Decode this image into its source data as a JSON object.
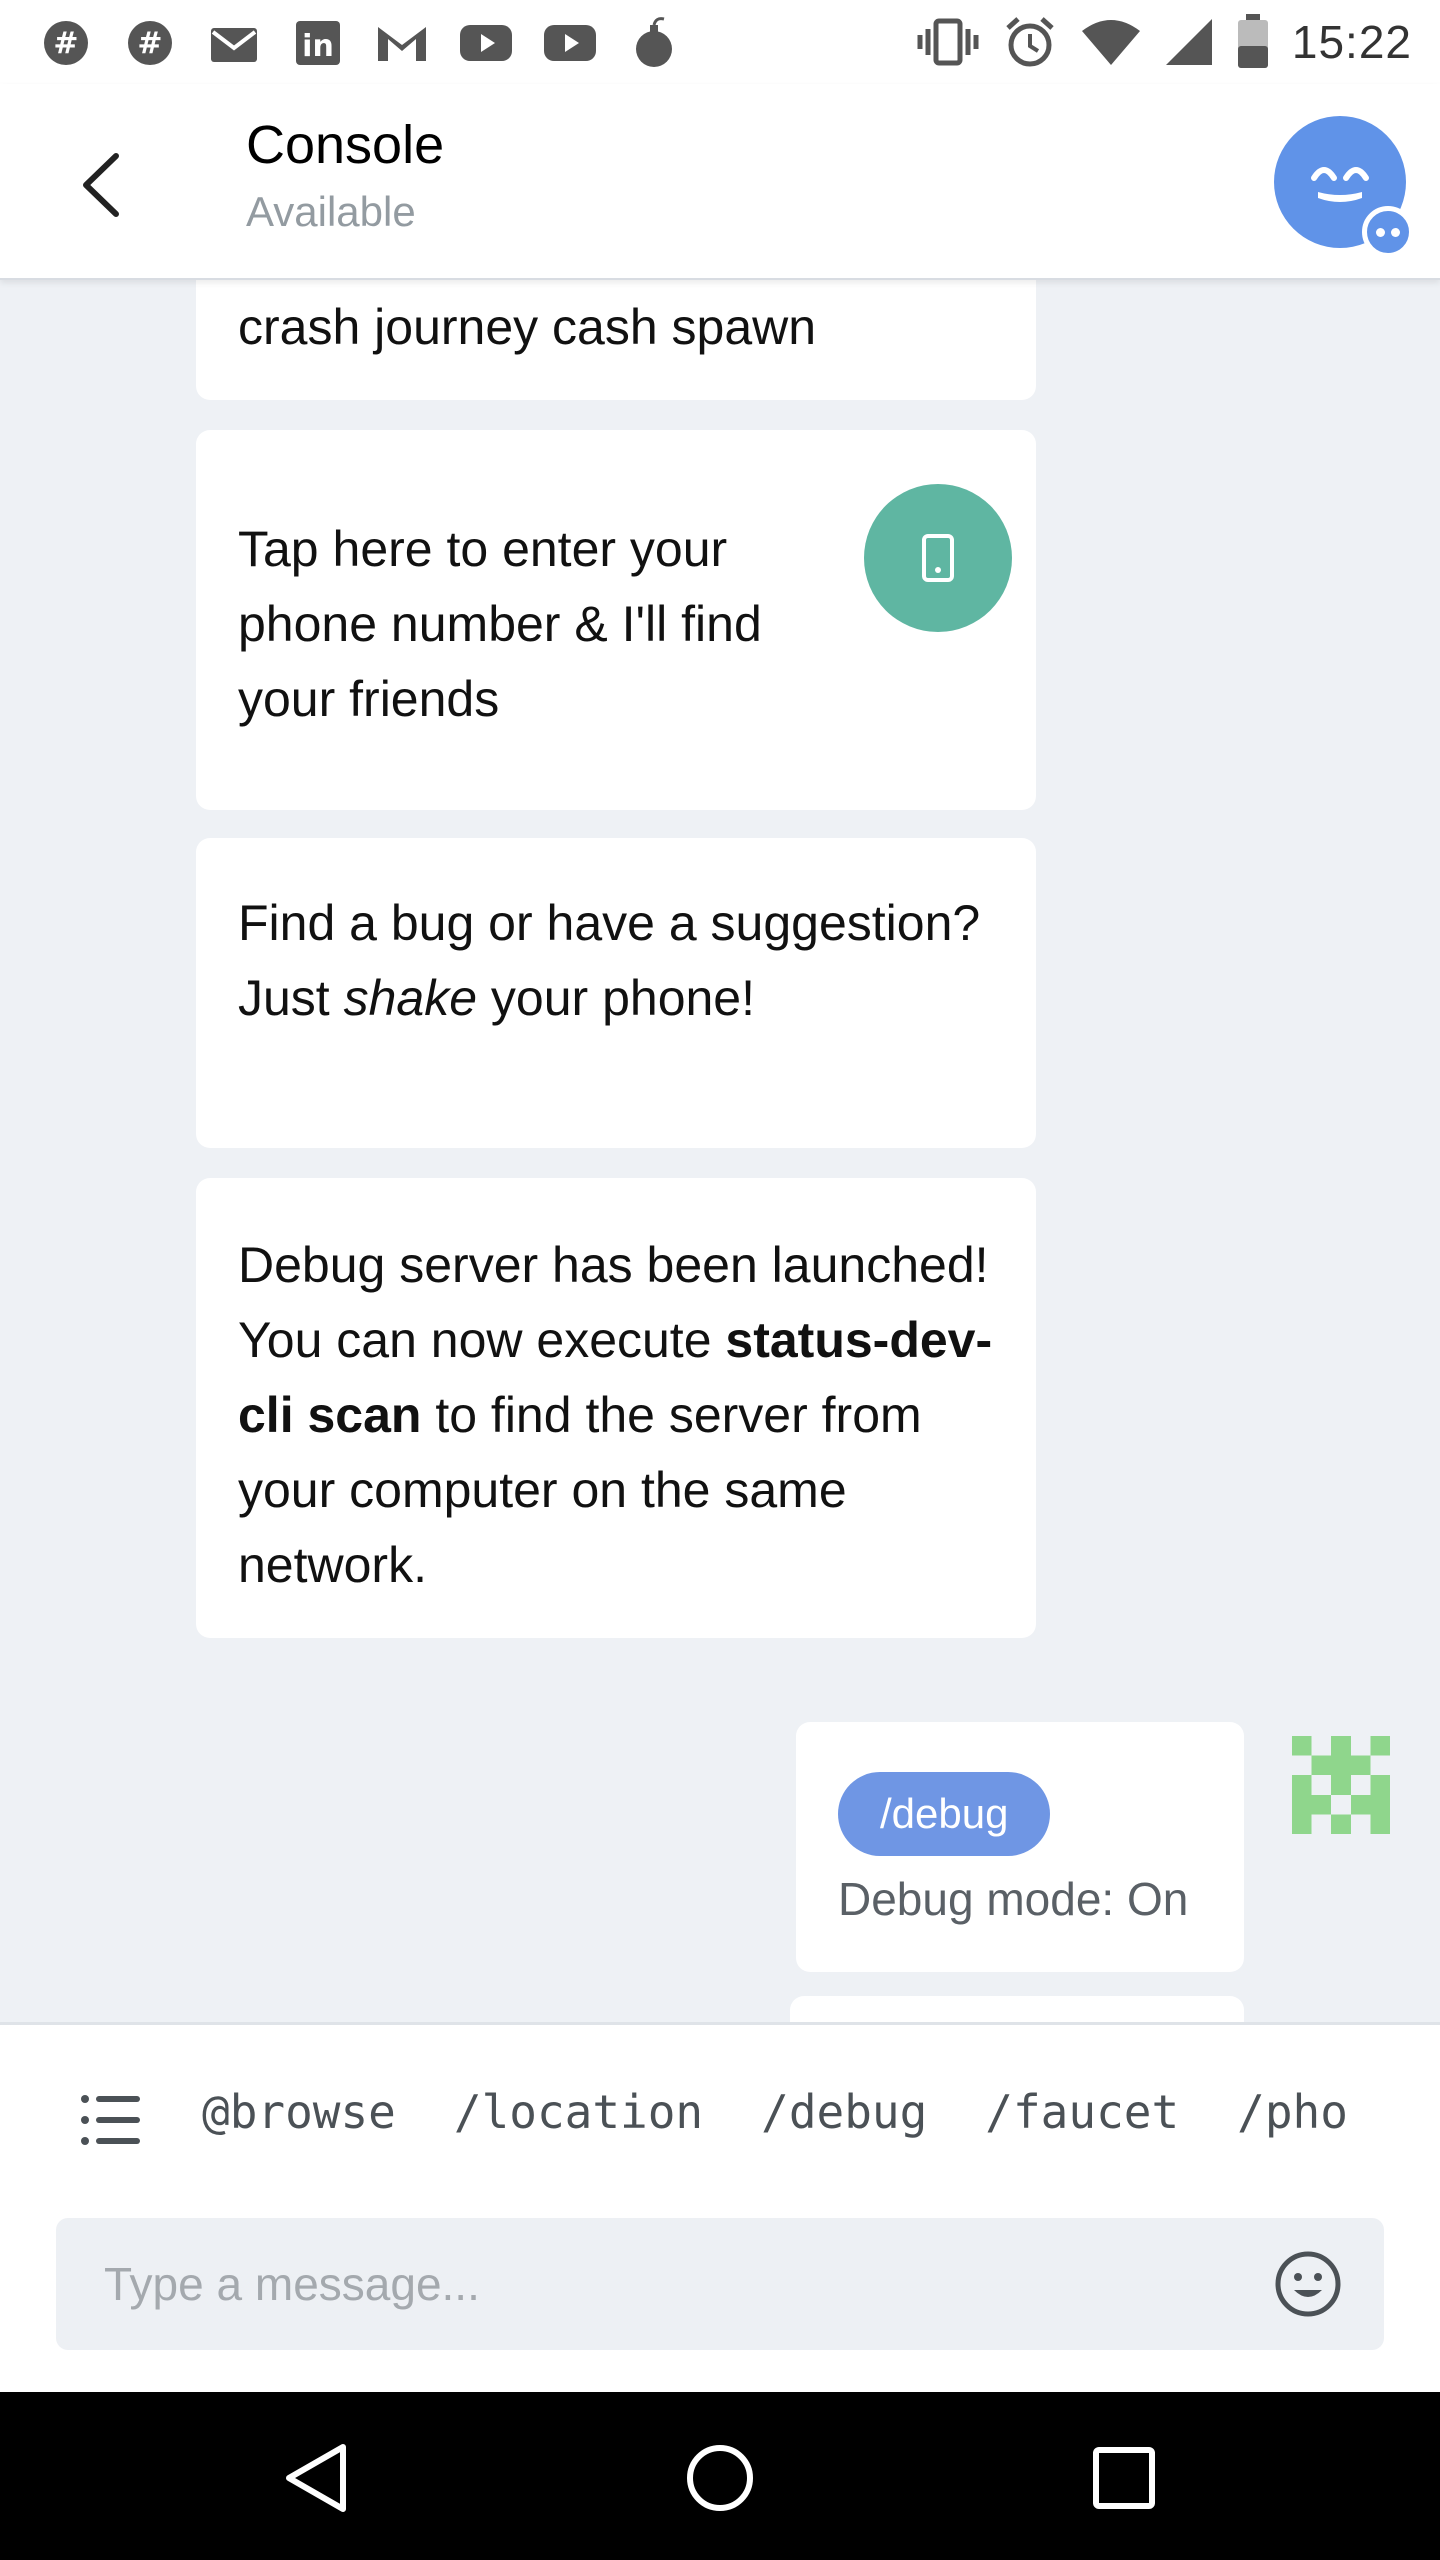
{
  "status_bar": {
    "time": "15:22",
    "left_icons": [
      "slack-icon",
      "slack-icon",
      "mail-icon",
      "linkedin-icon",
      "gmail-icon",
      "youtube-icon",
      "youtube-icon",
      "bomb-icon"
    ],
    "right_icons": [
      "vibrate-icon",
      "alarm-icon",
      "wifi-icon",
      "signal-icon",
      "battery-icon"
    ]
  },
  "header": {
    "title": "Console",
    "subtitle": "Available"
  },
  "messages": [
    {
      "text": "crash journey cash spawn"
    },
    {
      "text": "Tap here to enter your phone number & I'll find your friends"
    },
    {
      "text_before": "Find a bug or have a suggestion? Just ",
      "text_em": "shake",
      "text_after": " your phone!"
    },
    {
      "text_before": "Debug server has been launched! You can now execute ",
      "text_bold": "status-dev-cli scan",
      "text_after": " to find the server from your computer on the same network."
    }
  ],
  "outgoing": {
    "command": "/debug",
    "text": "Debug mode: On"
  },
  "commands": [
    "@browse",
    "/location",
    "/debug",
    "/faucet",
    "/pho"
  ],
  "input": {
    "placeholder": "Type a message..."
  },
  "colors": {
    "accent": "#6093e8",
    "pill": "#6f96e4",
    "phone_button": "#5fb6a2",
    "background": "#eef1f5",
    "identicon": "#8fd68c"
  }
}
